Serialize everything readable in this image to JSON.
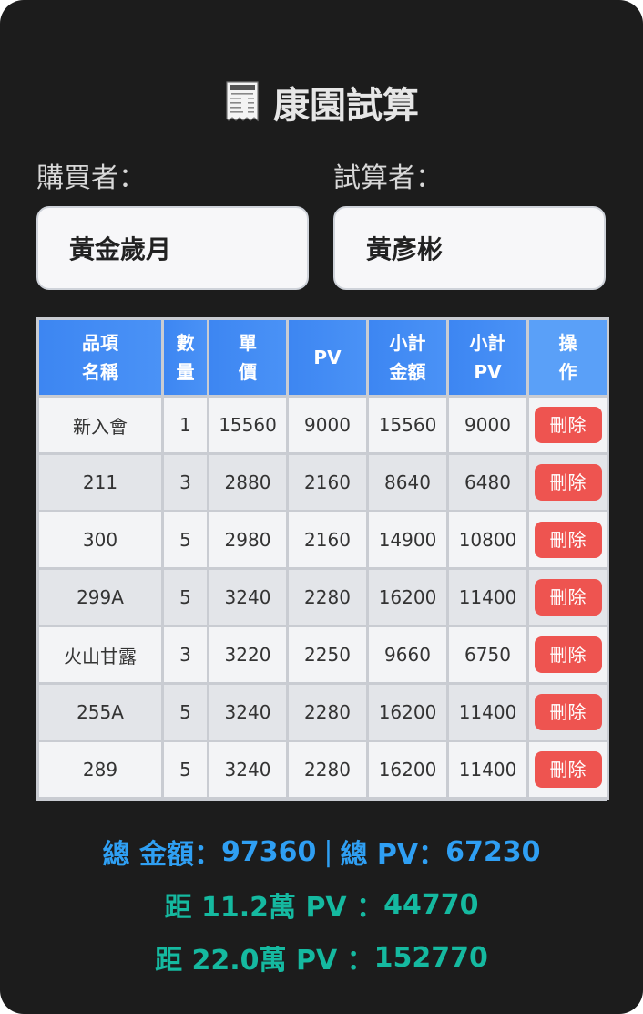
{
  "title": "康園試算",
  "icons": {
    "title_icon": "receipt-icon"
  },
  "buyer": {
    "label": "購買者：",
    "value": "黃金歲月"
  },
  "calculator": {
    "label": "試算者：",
    "value": "黃彥彬"
  },
  "table": {
    "headers": [
      [
        "品項",
        "名稱"
      ],
      [
        "數",
        "量"
      ],
      [
        "單",
        "價"
      ],
      [
        "PV"
      ],
      [
        "小計",
        "金額"
      ],
      [
        "小計",
        "PV"
      ],
      [
        "操",
        "作"
      ]
    ],
    "delete_label": "刪除",
    "rows": [
      [
        "新入會",
        "1",
        "15560",
        "9000",
        "15560",
        "9000"
      ],
      [
        "211",
        "3",
        "2880",
        "2160",
        "8640",
        "6480"
      ],
      [
        "300",
        "5",
        "2980",
        "2160",
        "14900",
        "10800"
      ],
      [
        "299A",
        "5",
        "3240",
        "2280",
        "16200",
        "11400"
      ],
      [
        "火山甘露",
        "3",
        "3220",
        "2250",
        "9660",
        "6750"
      ],
      [
        "255A",
        "5",
        "3240",
        "2280",
        "16200",
        "11400"
      ],
      [
        "289",
        "5",
        "3240",
        "2280",
        "16200",
        "11400"
      ]
    ]
  },
  "summary": {
    "total_amount_label": "總 金額：",
    "total_amount": "97360",
    "separator": "|",
    "total_pv_label": "總 PV：",
    "total_pv": "67230",
    "dist1_label": "距 11.2萬 PV ：",
    "dist1_value": "44770",
    "dist2_label": "距 22.0萬 PV ：",
    "dist2_value": "152770"
  },
  "colors": {
    "background": "#1c1c1c",
    "header_blue": "#3d86f2",
    "delete_red": "#ee5450",
    "totals_blue": "#2f9ff3",
    "distance_green": "#15b9a0"
  }
}
